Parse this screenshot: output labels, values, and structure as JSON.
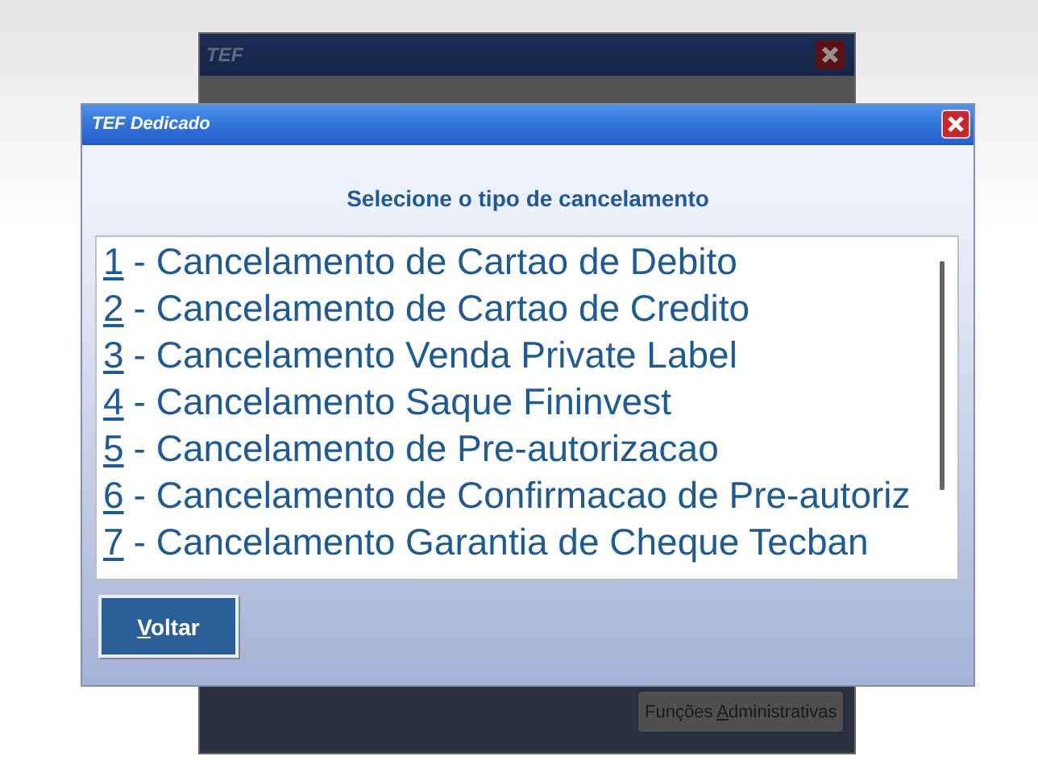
{
  "back_window": {
    "title": "TEF",
    "buttons": [
      {
        "parts": [
          {
            "text": "Funções ",
            "underline": false
          },
          {
            "text": "A",
            "underline": true
          },
          {
            "text": "dministrativas",
            "underline": false
          }
        ]
      }
    ]
  },
  "dialog": {
    "title": "TEF Dedicado",
    "heading": "Selecione o tipo de cancelamento",
    "items": [
      {
        "key": "1",
        "text": "- Cancelamento de Cartao de Debito"
      },
      {
        "key": "2",
        "text": "- Cancelamento de Cartao de Credito"
      },
      {
        "key": "3",
        "text": "- Cancelamento Venda Private Label"
      },
      {
        "key": "4",
        "text": "- Cancelamento Saque Fininvest"
      },
      {
        "key": "5",
        "text": "- Cancelamento de Pre-autorizacao"
      },
      {
        "key": "6",
        "text": "- Cancelamento de Confirmacao de Pre-autoriz"
      },
      {
        "key": "7",
        "text": "- Cancelamento Garantia de Cheque Tecban"
      }
    ],
    "buttons": [
      {
        "parts": [
          {
            "text": "V",
            "underline": true
          },
          {
            "text": "oltar",
            "underline": false
          }
        ]
      }
    ]
  }
}
